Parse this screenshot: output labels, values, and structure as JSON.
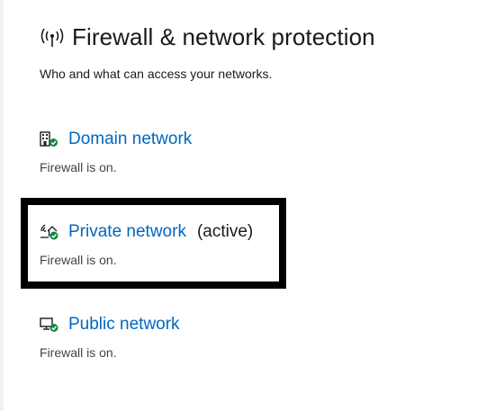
{
  "header": {
    "title": "Firewall & network protection",
    "icon": "wireless-signal-icon"
  },
  "subtitle": "Who and what can access your networks.",
  "networks": [
    {
      "label": "Domain network",
      "status": "Firewall is on.",
      "icon": "building-shield-icon",
      "active": false
    },
    {
      "label": "Private network",
      "active_label": "(active)",
      "status": "Firewall is on.",
      "icon": "home-wifi-shield-icon",
      "active": true
    },
    {
      "label": "Public network",
      "status": "Firewall is on.",
      "icon": "monitor-shield-icon",
      "active": false
    }
  ],
  "colors": {
    "link": "#0067c0",
    "status_check": "#10893e",
    "highlight": "#000000"
  }
}
